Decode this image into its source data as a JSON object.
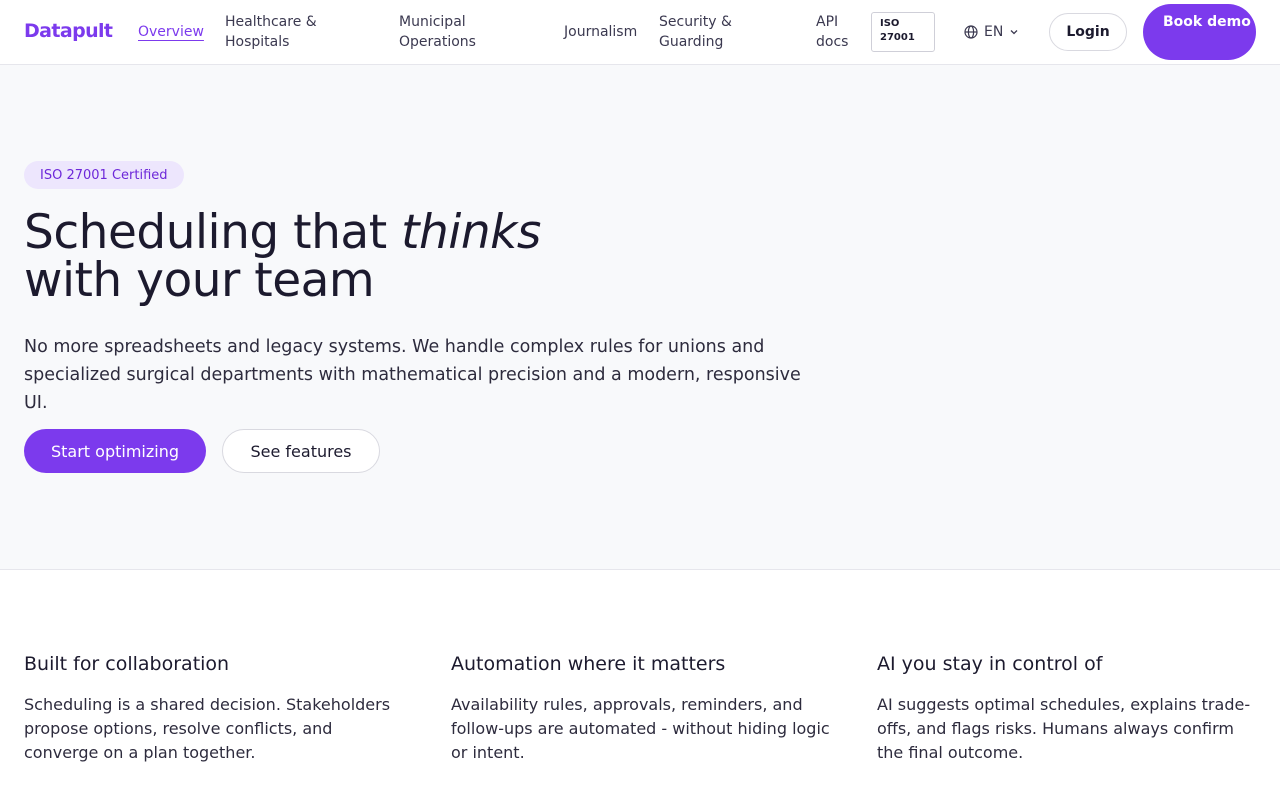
{
  "nav": {
    "logo": "Datapult",
    "links": [
      {
        "label": "Overview",
        "active": true
      },
      {
        "label": "Healthcare & Hospitals",
        "active": false
      },
      {
        "label": "Municipal Operations",
        "active": false
      },
      {
        "label": "Journalism",
        "active": false
      },
      {
        "label": "Security & Guarding",
        "active": false
      },
      {
        "label": "API docs",
        "active": false
      }
    ],
    "iso_badge": "ISO 27001",
    "language": "EN",
    "login_label": "Login",
    "demo_label": "Book demo"
  },
  "hero": {
    "badge": "ISO 27001 Certified",
    "title_start": "Scheduling that ",
    "title_emphasis": "thinks",
    "title_end": "with your team",
    "subtitle": "No more spreadsheets and legacy systems. We handle complex rules for unions and specialized surgical departments with mathematical precision and a modern, responsive UI.",
    "primary_cta": "Start optimizing",
    "secondary_cta": "See features"
  },
  "features": [
    {
      "title": "Built for collaboration",
      "body": "Scheduling is a shared decision. Stakeholders propose options, resolve conflicts, and converge on a plan together."
    },
    {
      "title": "Automation where it matters",
      "body": "Availability rules, approvals, reminders, and follow-ups are automated - without hiding logic or intent."
    },
    {
      "title": "AI you stay in control of",
      "body": "AI suggests optimal schedules, explains trade-offs, and flags risks. Humans always confirm the final outcome."
    }
  ],
  "colors": {
    "accent": "#7c3aed",
    "accent_soft": "#ede6fd",
    "hero_bg": "#f8f9fb",
    "text": "#1c1a2e"
  },
  "icons": {
    "language": "globe-icon",
    "language_dropdown": "chevron-down-icon"
  }
}
